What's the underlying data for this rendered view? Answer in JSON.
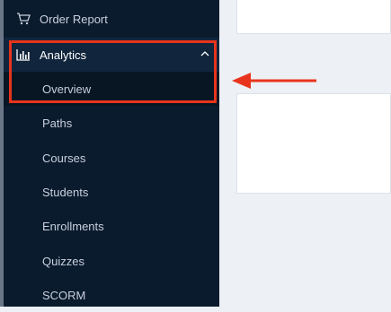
{
  "sidebar": {
    "order_report": {
      "label": "Order Report",
      "icon": "cart-icon"
    },
    "analytics": {
      "label": "Analytics",
      "icon": "bar-chart-icon",
      "expanded": true
    },
    "sub_items": [
      {
        "label": "Overview",
        "active": true
      },
      {
        "label": "Paths"
      },
      {
        "label": "Courses"
      },
      {
        "label": "Students"
      },
      {
        "label": "Enrollments"
      },
      {
        "label": "Quizzes"
      },
      {
        "label": "SCORM"
      }
    ]
  },
  "annotation": {
    "color": "#e8341c"
  },
  "colors": {
    "sidebar_bg": "#0b1b2e",
    "content_bg": "#edf0f4"
  }
}
